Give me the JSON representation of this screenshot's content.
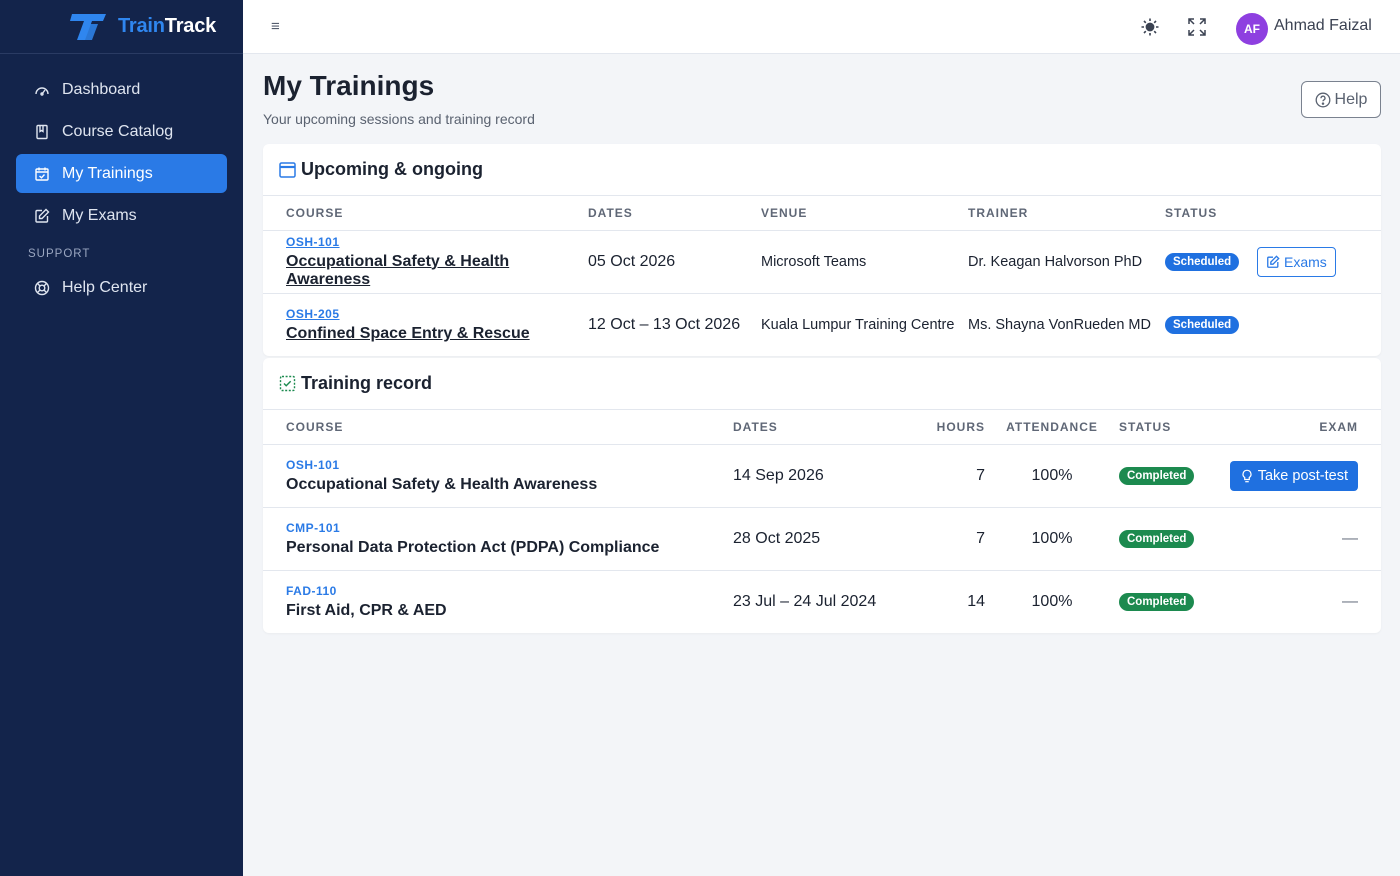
{
  "brand": {
    "name_part1": "Train",
    "name_part2": "Track"
  },
  "nav": {
    "items": [
      {
        "label": "Dashboard",
        "icon": "gauge-icon"
      },
      {
        "label": "Course Catalog",
        "icon": "book-icon"
      },
      {
        "label": "My Trainings",
        "icon": "calendar-check-icon",
        "active": true
      },
      {
        "label": "My Exams",
        "icon": "edit-icon"
      }
    ],
    "section_support": "SUPPORT",
    "support_items": [
      {
        "label": "Help Center",
        "icon": "lifebuoy-icon"
      }
    ]
  },
  "topbar": {
    "hamburger": "≡",
    "user_initials": "AF",
    "user_name": "Ahmad Faizal"
  },
  "page": {
    "title": "My Trainings",
    "subtitle": "Your upcoming sessions and training record",
    "help_label": "Help"
  },
  "upcoming": {
    "title": "Upcoming & ongoing",
    "columns": {
      "course": "COURSE",
      "dates": "DATES",
      "venue": "VENUE",
      "trainer": "TRAINER",
      "status": "STATUS"
    },
    "rows": [
      {
        "code": "OSH-101",
        "name": "Occupational Safety & Health Awareness",
        "dates": "05 Oct 2026",
        "venue": "Microsoft Teams",
        "trainer": "Dr. Keagan Halvorson PhD",
        "status": "Scheduled",
        "action": "Exams"
      },
      {
        "code": "OSH-205",
        "name": "Confined Space Entry & Rescue",
        "dates": "12 Oct – 13 Oct 2026",
        "venue": "Kuala Lumpur Training Centre",
        "trainer": "Ms. Shayna VonRueden MD",
        "status": "Scheduled",
        "action": ""
      }
    ]
  },
  "record": {
    "title": "Training record",
    "columns": {
      "course": "COURSE",
      "dates": "DATES",
      "hours": "HOURS",
      "attendance": "ATTENDANCE",
      "status": "STATUS",
      "exam": "EXAM"
    },
    "rows": [
      {
        "code": "OSH-101",
        "name": "Occupational Safety & Health Awareness",
        "dates": "14 Sep 2026",
        "hours": "7",
        "attendance": "100%",
        "status": "Completed",
        "exam": "Take post-test"
      },
      {
        "code": "CMP-101",
        "name": "Personal Data Protection Act (PDPA) Compliance",
        "dates": "28 Oct 2025",
        "hours": "7",
        "attendance": "100%",
        "status": "Completed",
        "exam": "—"
      },
      {
        "code": "FAD-110",
        "name": "First Aid, CPR & AED",
        "dates": "23 Jul – 24 Jul 2024",
        "hours": "14",
        "attendance": "100%",
        "status": "Completed",
        "exam": "—"
      }
    ]
  },
  "colors": {
    "sidebar_bg": "#13244b",
    "accent": "#2a7ae6",
    "scheduled": "#1f70e0",
    "completed": "#1c8a4f",
    "avatar": "#8e3fe0"
  }
}
